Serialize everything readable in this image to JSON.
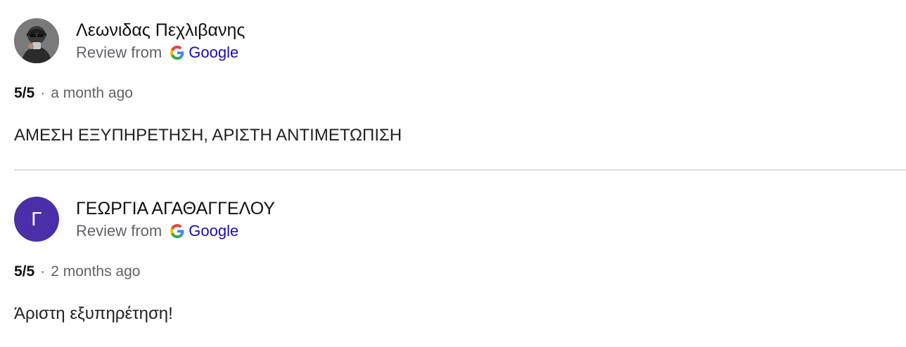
{
  "reviews": [
    {
      "author": "Λεωνιδας Πεχλιβανης",
      "avatar": {
        "type": "photo",
        "icon": "user-photo-icon"
      },
      "source_label": "Review from",
      "source_name": "Google",
      "rating": "5/5",
      "separator": "·",
      "time_ago": "a month ago",
      "text": "ΑΜΕΣΗ ΕΞΥΠΗΡΕΤΗΣΗ, ΑΡΙΣΤΗ ΑΝΤΙΜΕΤΩΠΙΣΗ"
    },
    {
      "author": "ΓΕΩΡΓΙΑ ΑΓΑΘΑΓΓΕΛΟΥ",
      "avatar": {
        "type": "initial",
        "initial": "Γ",
        "color": "#4b2fa8"
      },
      "source_label": "Review from",
      "source_name": "Google",
      "rating": "5/5",
      "separator": "·",
      "time_ago": "2 months ago",
      "text": "Άριστη εξυπηρέτηση!"
    }
  ],
  "colors": {
    "google_blue": "#4285F4",
    "google_red": "#EA4335",
    "google_yellow": "#FBBC05",
    "google_green": "#34A853",
    "link": "#1a0dab",
    "divider": "#dadce0"
  }
}
